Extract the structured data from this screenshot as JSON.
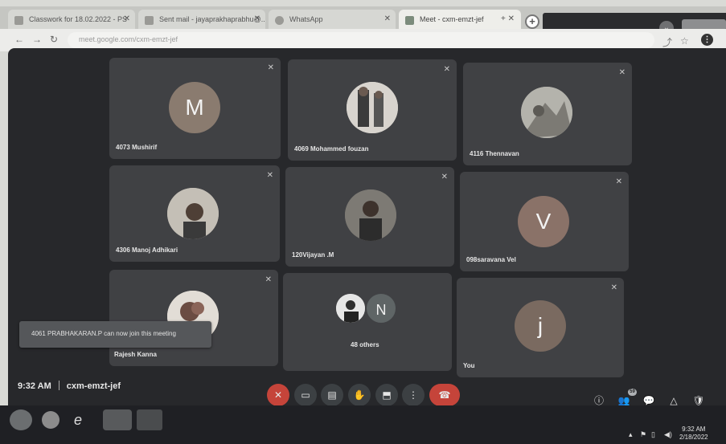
{
  "browser": {
    "tabs": [
      {
        "label": "Classwork for 18.02.2022 - PS"
      },
      {
        "label": "Sent mail - jayaprakhaprabhu@..."
      },
      {
        "label": "WhatsApp"
      },
      {
        "label": "Meet - cxm-emzt-jef"
      }
    ],
    "new_tab_label": "+",
    "url": "meet.google.com/cxm-emzt-jef"
  },
  "meet": {
    "participants": [
      {
        "name": "4073 Mushirif",
        "avatar_letter": "M",
        "avatar_color": "#8a7b6f"
      },
      {
        "name": "4069 Mohammed fouzan",
        "avatar_letter": "",
        "avatar_color": ""
      },
      {
        "name": "4116 Thennavan",
        "avatar_letter": "",
        "avatar_color": ""
      },
      {
        "name": "4306 Manoj Adhikari",
        "avatar_letter": "",
        "avatar_color": ""
      },
      {
        "name": "120Vijayan .M",
        "avatar_letter": "",
        "avatar_color": ""
      },
      {
        "name": "098saravana Vel",
        "avatar_letter": "V",
        "avatar_color": "#8a7268"
      },
      {
        "name": "Rajesh Kanna",
        "avatar_letter": "",
        "avatar_color": ""
      },
      {
        "name": "48 others",
        "avatar_letter": "N",
        "avatar_color": "#5f6566"
      },
      {
        "name": "You",
        "avatar_letter": "j",
        "avatar_color": "#7a6a60"
      }
    ],
    "toast": "4061 PRABHAKARAN.P can now join this meeting",
    "time": "9:32 AM",
    "meeting_code": "cxm-emzt-jef",
    "people_count": "59"
  },
  "taskbar": {
    "time": "9:32 AM",
    "date": "2/18/2022"
  },
  "colors": {
    "meet_background": "#27282b",
    "tile_background": "#404144",
    "hangup_red": "#c5443a"
  }
}
